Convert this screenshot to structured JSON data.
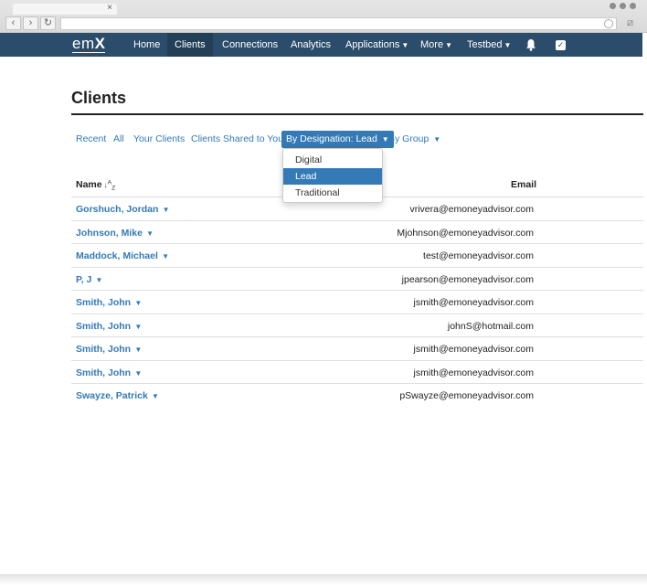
{
  "browser": {
    "tab_close": "×"
  },
  "nav": {
    "brand_prefix": "em",
    "brand_suffix": "X",
    "items": [
      {
        "label": "Home"
      },
      {
        "label": "Clients"
      },
      {
        "label": "Connections"
      },
      {
        "label": "Analytics"
      },
      {
        "label": "Applications"
      },
      {
        "label": "More"
      },
      {
        "label": "Testbed"
      }
    ],
    "active": "Clients"
  },
  "page": {
    "title": "Clients"
  },
  "filters": {
    "recent": "Recent",
    "all": "All",
    "your_clients": "Your Clients",
    "shared": "Clients Shared to You",
    "designation": "By Designation: Lead",
    "group": "By Group"
  },
  "designation_menu": {
    "options": [
      "Digital",
      "Lead",
      "Traditional"
    ],
    "selected": "Lead"
  },
  "table": {
    "col_name": "Name",
    "col_email": "Email",
    "rows": [
      {
        "name": "Gorshuch, Jordan",
        "email": "vrivera@emoneyadvisor.com"
      },
      {
        "name": "Johnson, Mike",
        "email": "Mjohnson@emoneyadvisor.com"
      },
      {
        "name": "Maddock, Michael",
        "email": "test@emoneyadvisor.com"
      },
      {
        "name": "P, J",
        "email": "jpearson@emoneyadvisor.com"
      },
      {
        "name": "Smith, John",
        "email": "jsmith@emoneyadvisor.com"
      },
      {
        "name": "Smith, John",
        "email": "johnS@hotmail.com"
      },
      {
        "name": "Smith, John",
        "email": "jsmith@emoneyadvisor.com"
      },
      {
        "name": "Smith, John",
        "email": "jsmith@emoneyadvisor.com"
      },
      {
        "name": "Swayze, Patrick",
        "email": "pSwayze@emoneyadvisor.com"
      }
    ]
  },
  "colors": {
    "navbar": "#2b4d6b",
    "link": "#337ab7"
  }
}
